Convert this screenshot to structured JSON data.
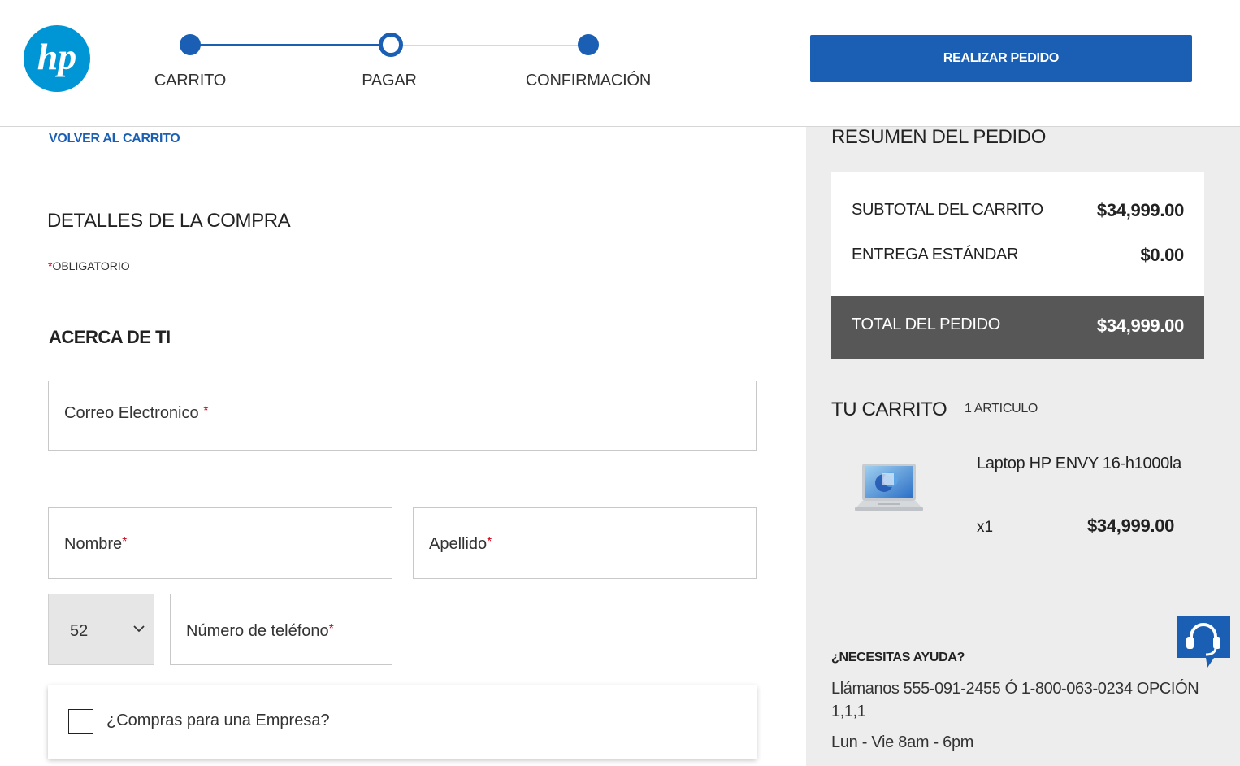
{
  "header": {
    "logo_text": "hp",
    "steps": [
      {
        "label": "CARRITO",
        "state": "done"
      },
      {
        "label": "PAGAR",
        "state": "current"
      },
      {
        "label": "CONFIRMACIÓN",
        "state": "pending"
      }
    ],
    "place_order_label": "REALIZAR PEDIDO"
  },
  "form": {
    "back_link": "VOLVER AL CARRITO",
    "section_title": "DETALLES DE LA COMPRA",
    "required_asterisk": "*",
    "required_note": "OBLIGATORIO",
    "about_title": "ACERCA DE TI",
    "email_placeholder": "Correo Electronico",
    "first_name_placeholder": "Nombre",
    "last_name_placeholder": "Apellido",
    "country_code_value": "52",
    "phone_placeholder": "Número de teléfono",
    "business_checkbox_label": "¿Compras para una Empresa?",
    "business_checked": false
  },
  "summary": {
    "title": "RESUMEN DEL PEDIDO",
    "subtotal_label": "SUBTOTAL DEL CARRITO",
    "subtotal_value": "$34,999.00",
    "shipping_label": "ENTREGA ESTÁNDAR",
    "shipping_value": "$0.00",
    "total_label": "TOTAL DEL PEDIDO",
    "total_value": "$34,999.00"
  },
  "cart": {
    "title": "TU CARRITO",
    "count": "1 ARTICULO",
    "items": [
      {
        "name": "Laptop HP ENVY 16-h1000la",
        "qty": "x1",
        "price": "$34,999.00"
      }
    ]
  },
  "help": {
    "title": "¿NECESITAS AYUDA?",
    "phone_line": "Llámanos 555-091-2455 Ó 1-800-063-0234 OPCIÓN 1,1,1",
    "hours": "Lun - Vie 8am - 6pm"
  },
  "colors": {
    "brand_blue": "#1a5fb4",
    "total_bar": "#575757",
    "panel_bg": "#ededed",
    "required_red": "#d0021b"
  }
}
